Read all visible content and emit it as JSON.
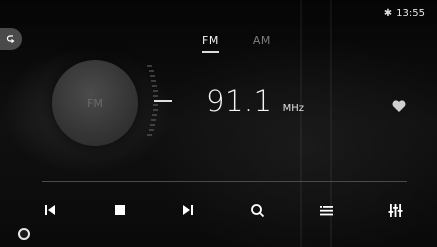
{
  "status": {
    "time": "13:55",
    "bluetooth_icon": "bluetooth-icon"
  },
  "tabs": [
    {
      "label": "FM",
      "active": true
    },
    {
      "label": "AM",
      "active": false
    }
  ],
  "dial": {
    "label": "FM"
  },
  "tuner": {
    "frequency": "91.1",
    "unit": "MHz"
  },
  "controls": {
    "prev_icon": "skip-previous-icon",
    "stop_icon": "stop-icon",
    "next_icon": "skip-next-icon",
    "search_icon": "search-icon",
    "list_icon": "list-icon",
    "equalizer_icon": "equalizer-icon"
  },
  "favorite": {
    "icon": "heart-icon",
    "color": "#cfcfcf"
  },
  "colors": {
    "active_text": "#f2f2f2",
    "inactive_text": "#7d7d7d",
    "dial": "#363636"
  }
}
